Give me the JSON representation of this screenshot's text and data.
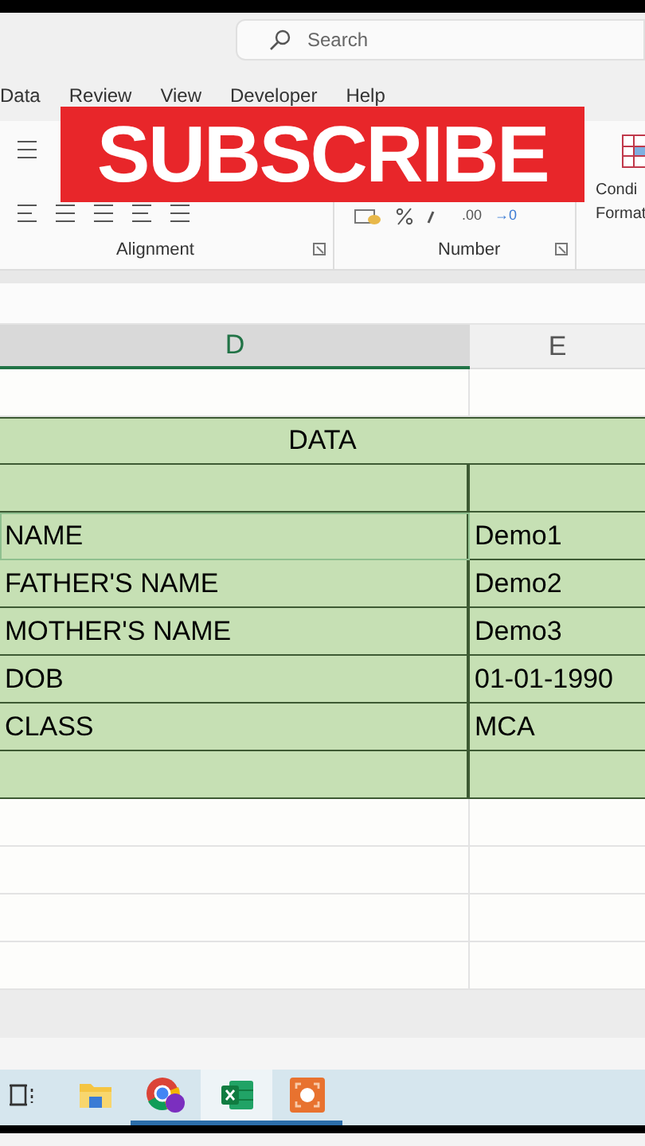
{
  "search": {
    "placeholder": "Search"
  },
  "menu_tabs": [
    {
      "label": "Data",
      "selected": false
    },
    {
      "label": "Review",
      "selected": false
    },
    {
      "label": "View",
      "selected": false
    },
    {
      "label": "Developer",
      "selected": false
    },
    {
      "label": "Help",
      "selected": false
    }
  ],
  "ribbon": {
    "groups": [
      "Alignment",
      "Number"
    ],
    "number_formats": [
      ".00",
      "→0"
    ],
    "conditional_label": [
      "Condi",
      "Format"
    ]
  },
  "banner": {
    "text": "SUBSCRIBE"
  },
  "sheet": {
    "columns": [
      {
        "label": "D",
        "selected": true
      },
      {
        "label": "E",
        "selected": false
      }
    ],
    "rows": [
      {
        "kind": "blank",
        "cells": [
          "",
          ""
        ]
      },
      {
        "kind": "merged",
        "cells": [
          "DATA"
        ]
      },
      {
        "kind": "green",
        "cells": [
          "",
          ""
        ],
        "selected": false
      },
      {
        "kind": "green",
        "cells": [
          "NAME",
          "Demo1"
        ],
        "selected": true
      },
      {
        "kind": "green",
        "cells": [
          "FATHER'S NAME",
          "Demo2"
        ],
        "selected": false
      },
      {
        "kind": "green",
        "cells": [
          "MOTHER'S NAME",
          "Demo3"
        ],
        "selected": false
      },
      {
        "kind": "green",
        "cells": [
          "DOB",
          "01-01-1990"
        ],
        "selected": false
      },
      {
        "kind": "green",
        "cells": [
          "CLASS",
          "MCA"
        ],
        "selected": false
      },
      {
        "kind": "green",
        "cells": [
          "",
          ""
        ],
        "selected": false
      },
      {
        "kind": "blank",
        "cells": [
          "",
          ""
        ]
      },
      {
        "kind": "blank",
        "cells": [
          "",
          ""
        ]
      },
      {
        "kind": "blank",
        "cells": [
          "",
          ""
        ]
      },
      {
        "kind": "blank",
        "cells": [
          "",
          ""
        ]
      }
    ]
  },
  "taskbar": [
    {
      "kind": "taskview",
      "selected": false,
      "running": false
    },
    {
      "kind": "folder",
      "selected": false,
      "running": false
    },
    {
      "kind": "browser",
      "selected": false,
      "running": true
    },
    {
      "kind": "excel",
      "selected": true,
      "running": true
    },
    {
      "kind": "recorder",
      "selected": false,
      "running": true
    }
  ]
}
